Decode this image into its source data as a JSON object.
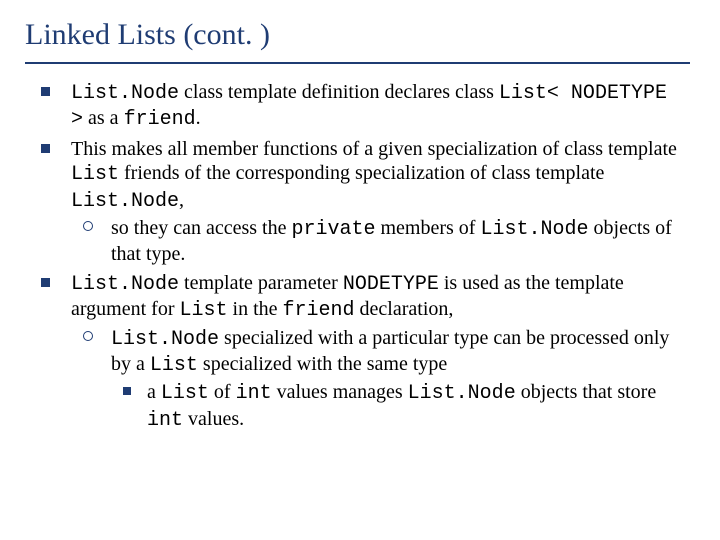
{
  "title": "Linked Lists (cont. )",
  "bullets": {
    "b1": {
      "t1": "List.Node",
      "t2": " class template definition declares class ",
      "t3": "List< NODETYPE >",
      "t4": " as a ",
      "t5": "friend",
      "t6": "."
    },
    "b2": {
      "t1": "This makes all member functions of a given specialization of class template ",
      "t2": "List",
      "t3": " friends of the corresponding specialization of class template ",
      "t4": "List.Node",
      "t5": ",",
      "sub1": {
        "t1": "so they can access the ",
        "t2": "private",
        "t3": " members of ",
        "t4": "List.Node",
        "t5": " objects of that type."
      }
    },
    "b3": {
      "t1": "List.Node",
      "t2": " template parameter ",
      "t3": "NODETYPE",
      "t4": " is used as the template argument for ",
      "t5": "List",
      "t6": " in the ",
      "t7": "friend",
      "t8": " declaration,",
      "sub1": {
        "t1": "List.Node",
        "t2": " specialized with a particular type can be processed only by a ",
        "t3": "List",
        "t4": " specialized with the same type",
        "sub1": {
          "t1": "a ",
          "t2": "List",
          "t3": " of ",
          "t4": "int",
          "t5": " values manages ",
          "t6": "List.Node",
          "t7": " objects that store ",
          "t8": "int",
          "t9": " values."
        }
      }
    }
  }
}
